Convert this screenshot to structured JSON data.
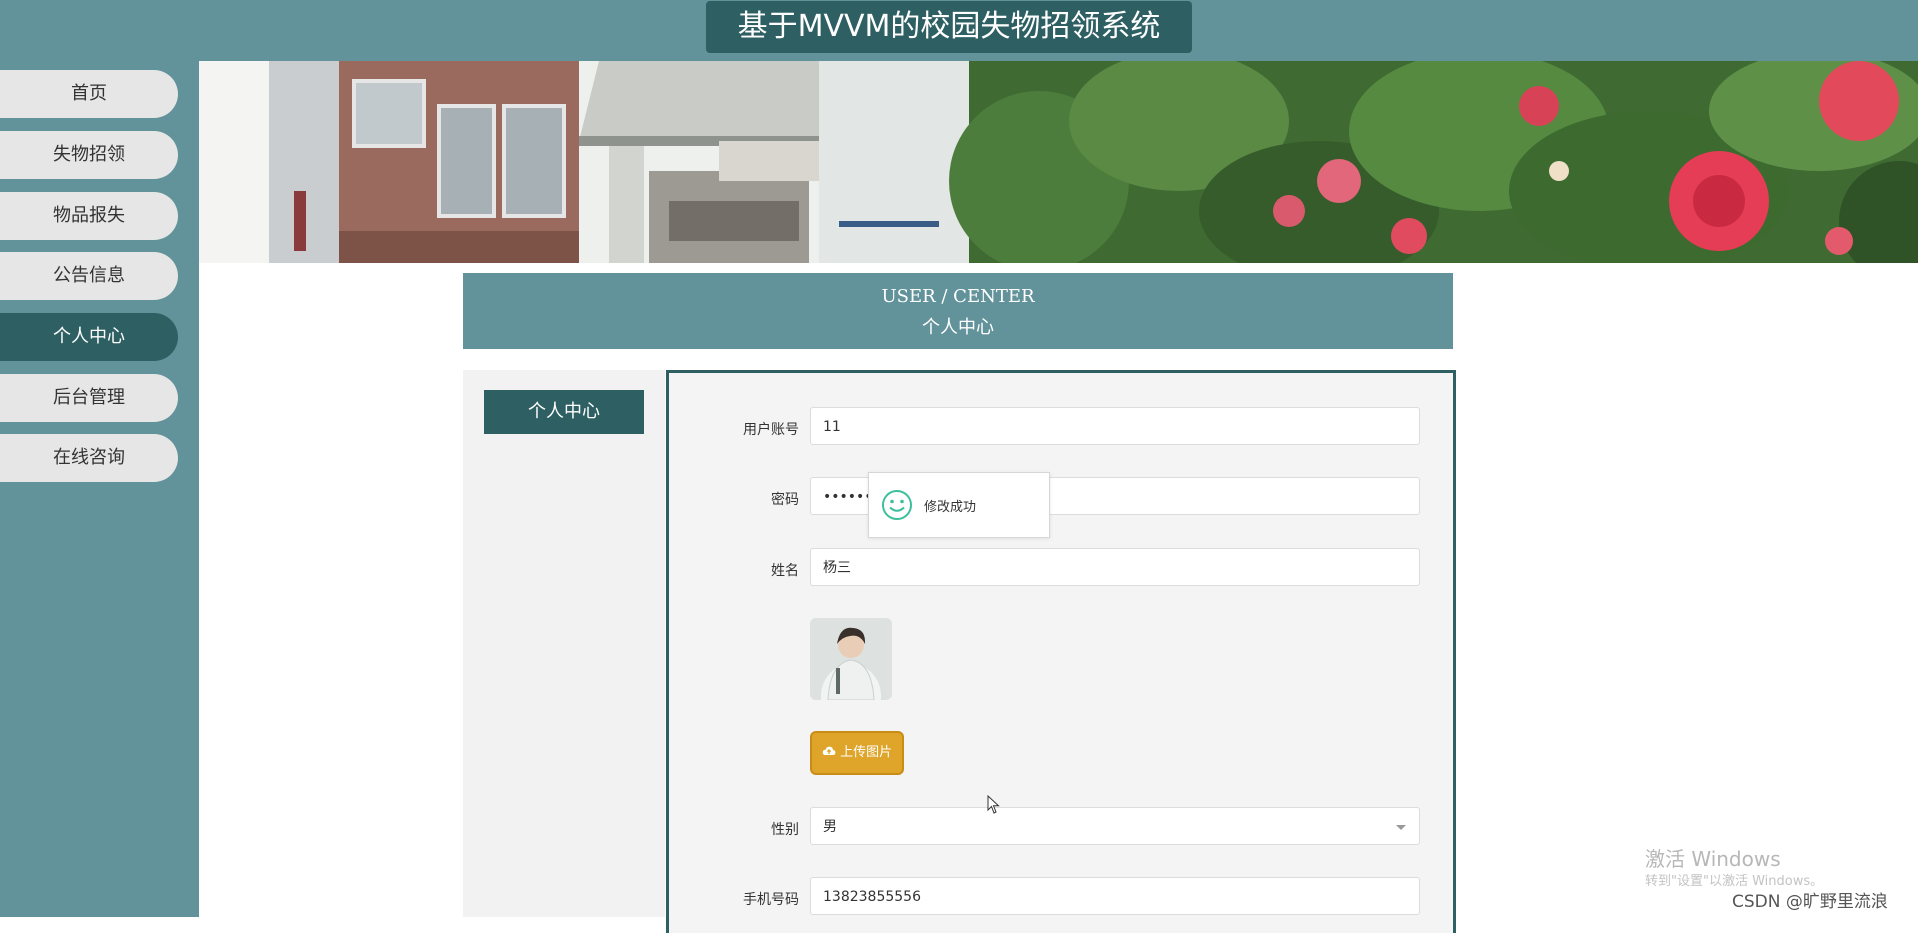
{
  "header": {
    "title": "基于MVVM的校园失物招领系统"
  },
  "sidebar": {
    "items": [
      {
        "label": "首页"
      },
      {
        "label": "失物招领"
      },
      {
        "label": "物品报失"
      },
      {
        "label": "公告信息"
      },
      {
        "label": "个人中心",
        "active": true
      },
      {
        "label": "后台管理"
      },
      {
        "label": "在线咨询"
      }
    ]
  },
  "section": {
    "title_en": "USER / CENTER",
    "title_cn": "个人中心"
  },
  "left_menu": {
    "active_item": "个人中心"
  },
  "form": {
    "account": {
      "label": "用户账号",
      "value": "11"
    },
    "password": {
      "label": "密码",
      "value": "••••••"
    },
    "name": {
      "label": "姓名",
      "value": "杨三"
    },
    "upload_label": "上传图片",
    "gender": {
      "label": "性别",
      "value": "男"
    },
    "phone": {
      "label": "手机号码",
      "value": "13823855556"
    }
  },
  "toast": {
    "message": "修改成功"
  },
  "overlay": {
    "activate_title": "激活 Windows",
    "activate_sub": "转到\"设置\"以激活 Windows。",
    "csdn": "CSDN @旷野里流浪"
  },
  "colors": {
    "primary": "#62929a",
    "primary_dark": "#2e5f63",
    "upload": "#dea52a"
  }
}
